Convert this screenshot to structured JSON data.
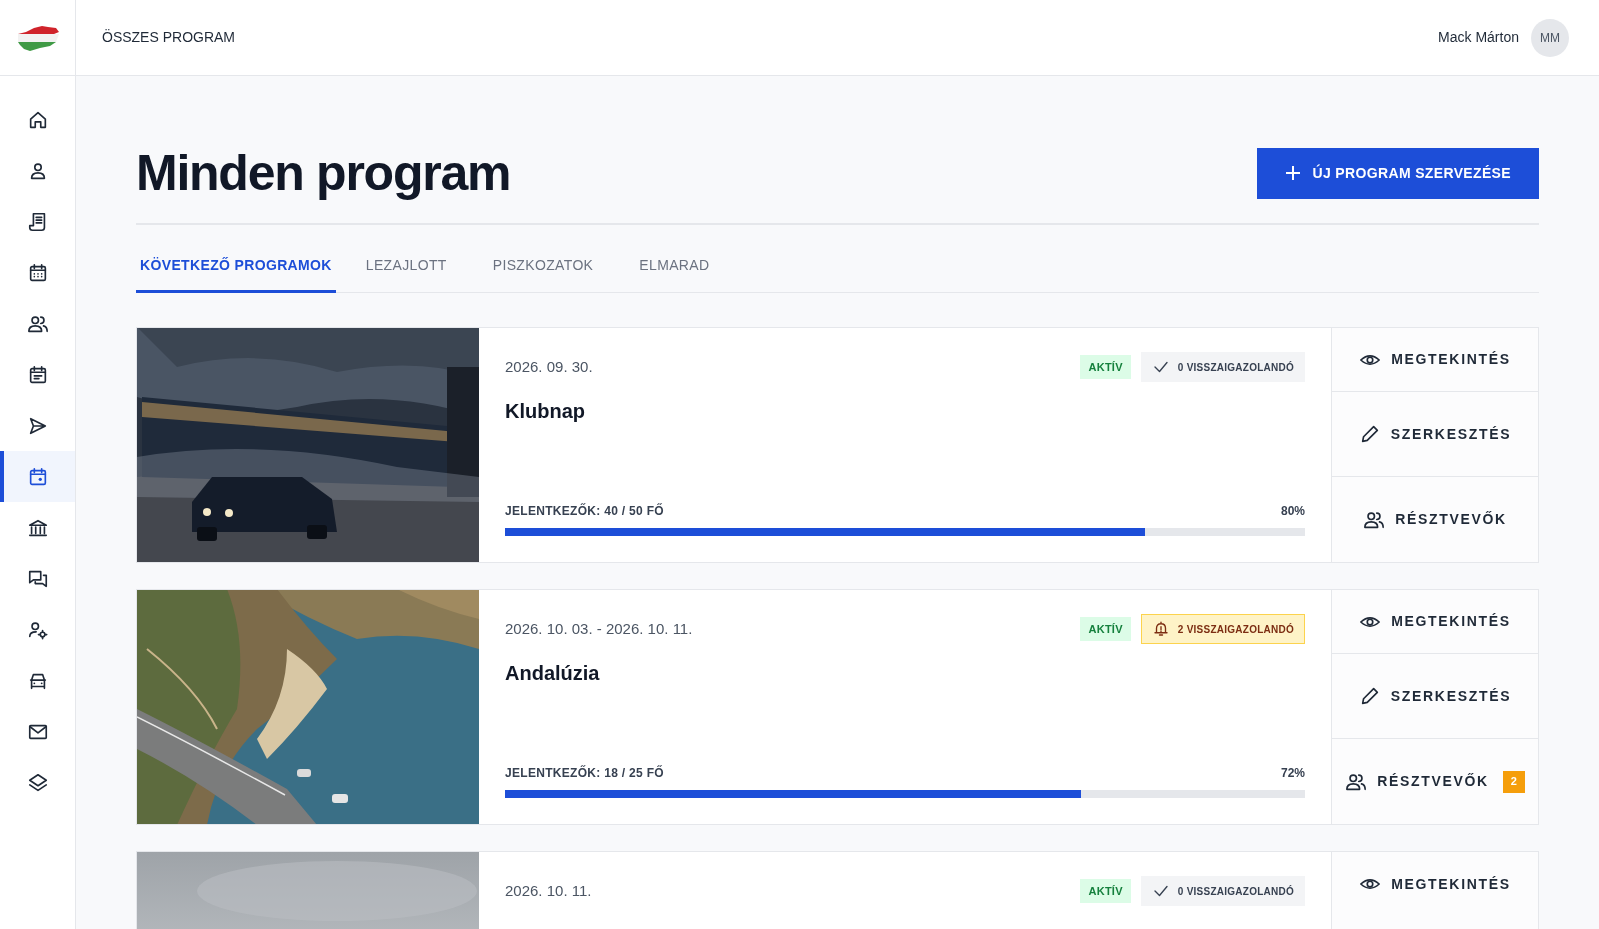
{
  "header": {
    "title": "ÖSSZES PROGRAM",
    "user_name": "Mack Márton",
    "avatar_initials": "MM"
  },
  "sidebar": {
    "items": [
      {
        "selected": false
      },
      {
        "selected": false
      },
      {
        "selected": false
      },
      {
        "selected": false
      },
      {
        "selected": false
      },
      {
        "selected": false
      },
      {
        "selected": false
      },
      {
        "selected": true
      },
      {
        "selected": false
      },
      {
        "selected": false
      },
      {
        "selected": false
      },
      {
        "selected": false
      },
      {
        "selected": false
      },
      {
        "selected": false
      }
    ]
  },
  "page": {
    "title": "Minden program",
    "new_button": "ÚJ PROGRAM SZERVEZÉSE"
  },
  "tabs": [
    {
      "label": "KÖVETKEZŐ PROGRAMOK",
      "selected": true
    },
    {
      "label": "LEZAJLOTT",
      "selected": false
    },
    {
      "label": "PISZKOZATOK",
      "selected": false
    },
    {
      "label": "ELMARAD",
      "selected": false
    }
  ],
  "programs": [
    {
      "date": "2026. 09. 30.",
      "title": "Klubnap",
      "status": "AKTÍV",
      "pending": {
        "kind": "ok",
        "label": "0 VISSZAIGAZOLANDÓ"
      },
      "registrants": {
        "label": "JELENTKEZŐK: 40 / 50 FŐ",
        "percent": "80%",
        "level": 0.8
      },
      "actions": [
        {
          "kind": "view",
          "label": "MEGTEKINTÉS"
        },
        {
          "kind": "edit",
          "label": "SZERKESZTÉS"
        },
        {
          "kind": "participants",
          "label": "RÉSZTVEVŐK"
        }
      ]
    },
    {
      "date": "2026. 10. 03. - 2026. 10. 11.",
      "title": "Andalúzia",
      "status": "AKTÍV",
      "pending": {
        "kind": "warning",
        "label": "2 VISSZAIGAZOLANDÓ"
      },
      "registrants": {
        "label": "JELENTKEZŐK: 18 / 25 FŐ",
        "percent": "72%",
        "level": 0.72
      },
      "actions": [
        {
          "kind": "view",
          "label": "MEGTEKINTÉS"
        },
        {
          "kind": "edit",
          "label": "SZERKESZTÉS"
        },
        {
          "kind": "participants",
          "label": "RÉSZTVEVŐK",
          "count": "2"
        }
      ]
    },
    {
      "date": "2026. 10. 11.",
      "status": "AKTÍV",
      "pending": {
        "kind": "ok",
        "label": "0 VISSZAIGAZOLANDÓ"
      },
      "actions": [
        {
          "kind": "view",
          "label": "MEGTEKINTÉS"
        }
      ]
    }
  ]
}
